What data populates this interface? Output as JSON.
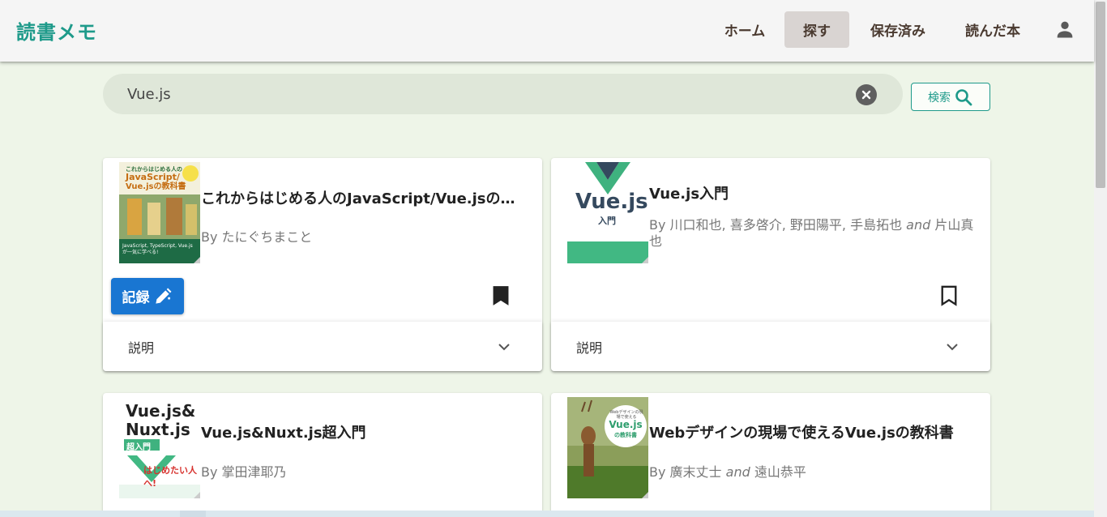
{
  "app": {
    "brand": "読書メモ"
  },
  "nav": {
    "items": [
      {
        "label": "ホーム",
        "active": false
      },
      {
        "label": "探す",
        "active": true
      },
      {
        "label": "保存済み",
        "active": false
      },
      {
        "label": "読んだ本",
        "active": false
      }
    ],
    "account_icon": "account-icon"
  },
  "search": {
    "value": "Vue.js",
    "placeholder": "",
    "button_label": "検索"
  },
  "books": [
    {
      "title": "これからはじめる人のJavaScript/Vue.jsの教科書",
      "by": "By",
      "author": "たにぐちまこと",
      "author_rest": "",
      "and": "",
      "author_last": "",
      "record_label": "記録",
      "bookmarked": true,
      "description_label": "説明",
      "cover": {
        "top_text": "これからはじめる人の",
        "main_text_1": "JavaScript/",
        "main_text_2": "Vue.jsの教科書",
        "bottom_text": "JavaScript, TypeScript, Vue.jsが一気に学べる!"
      }
    },
    {
      "title": "Vue.js入門",
      "by": "By",
      "author": "川口和也, 喜多啓介, 野田陽平, 手島拓也",
      "and": "and",
      "author_last": "片山真也",
      "bookmarked": false,
      "description_label": "説明",
      "cover": {
        "main_text_1": "Vue.js",
        "main_text_2": "入門"
      }
    },
    {
      "title": "Vue.js&Nuxt.js超入門",
      "by": "By",
      "author": "掌田津耶乃",
      "cover": {
        "main_text_1": "Vue.js&",
        "main_text_2": "Nuxt.js",
        "badge": "超入門",
        "sub_text": "はじめたい人へ!"
      }
    },
    {
      "title": "Webデザインの現場で使えるVue.jsの教科書",
      "by": "By",
      "author": "廣末丈士",
      "and": "and",
      "author_last": "遠山恭平",
      "cover": {
        "top_text": "Webデザインの現場で使える",
        "main_text_1": "Vue.js",
        "main_text_2": "の教科書"
      }
    }
  ],
  "colors": {
    "brand": "#1e9a8a",
    "primary_button": "#1976d2",
    "page_background": "#eef5e8",
    "active_nav": "#d9d4d2"
  }
}
